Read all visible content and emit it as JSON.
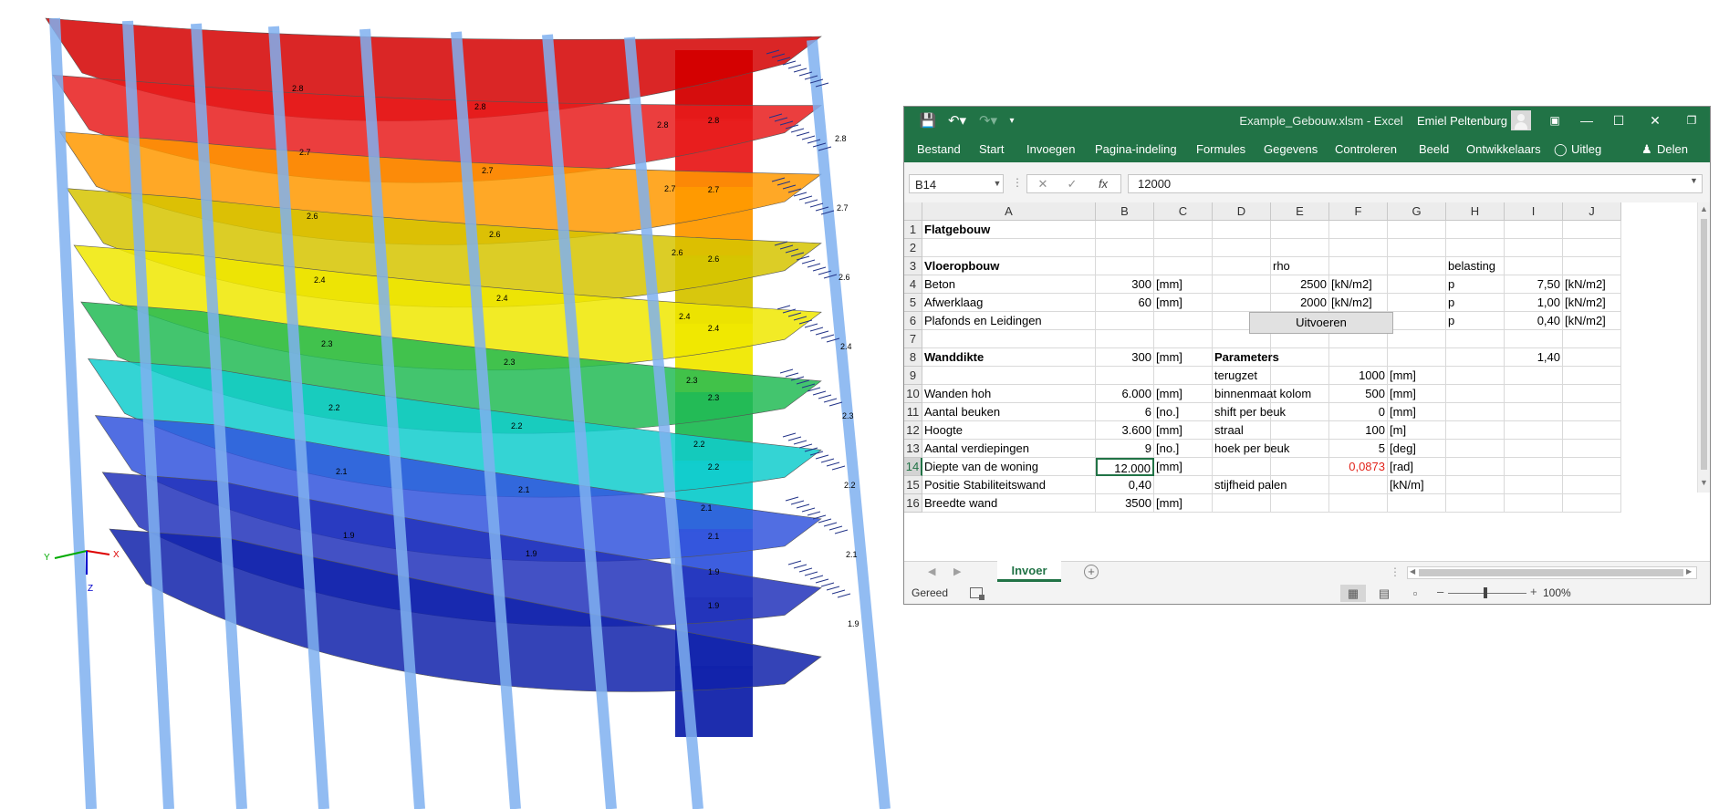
{
  "excel": {
    "file_title": "Example_Gebouw.xlsm  -  Excel",
    "user_name": "Emiel Peltenburg",
    "tabs": [
      "Bestand",
      "Start",
      "Invoegen",
      "Pagina-indeling",
      "Formules",
      "Gegevens",
      "Controleren",
      "Beeld",
      "Ontwikkelaars",
      "Uitleg",
      "Delen"
    ],
    "name_box": "B14",
    "formula_value": "12000",
    "fx_label": "fx",
    "column_headers": [
      "A",
      "B",
      "C",
      "D",
      "E",
      "F",
      "G",
      "H",
      "I",
      "J"
    ],
    "row_numbers": [
      "1",
      "2",
      "3",
      "4",
      "5",
      "6",
      "7",
      "8",
      "9",
      "10",
      "11",
      "12",
      "13",
      "14",
      "15",
      "16"
    ],
    "cells": {
      "A1": "Flatgebouw",
      "A3": "Vloeropbouw",
      "E3": "rho",
      "H3": "belasting",
      "A4": "Beton",
      "B4": "300",
      "C4": "[mm]",
      "E4": "2500",
      "F4": "[kN/m2]",
      "H4": "p",
      "I4": "7,50",
      "J4": "[kN/m2]",
      "A5": "Afwerklaag",
      "B5": "60",
      "C5": "[mm]",
      "E5": "2000",
      "F5": "[kN/m2]",
      "H5": "p",
      "I5": "1,00",
      "J5": "[kN/m2]",
      "A6": "Plafonds en Leidingen",
      "H6": "p",
      "I6": "0,40",
      "J6": "[kN/m2]",
      "A8": "Wanddikte",
      "B8": "300",
      "C8": "[mm]",
      "D8": "Parameters",
      "I8": "1,40",
      "D9": "terugzet",
      "F9": "1000",
      "G9": "[mm]",
      "A10": "Wanden hoh",
      "B10": "6.000",
      "C10": "[mm]",
      "D10": "binnenmaat kolom",
      "F10": "500",
      "G10": "[mm]",
      "A11": "Aantal beuken",
      "B11": "6",
      "C11": "[no.]",
      "D11": "shift per beuk",
      "F11": "0",
      "G11": "[mm]",
      "A12": "Hoogte",
      "B12": "3.600",
      "C12": "[mm]",
      "D12": "straal",
      "F12": "100",
      "G12": "[m]",
      "A13": "Aantal verdiepingen",
      "B13": "9",
      "C13": "[no.]",
      "D13": "hoek per beuk",
      "F13": "5",
      "G13": "[deg]",
      "A14": "Diepte van de woning",
      "B14": "12.000",
      "C14": "[mm]",
      "F14": "0,0873",
      "G14": "[rad]",
      "A15": "Positie Stabiliteitswand",
      "B15": "0,40",
      "D15": "stijfheid palen",
      "G15": "[kN/m]",
      "A16": "Breedte wand",
      "B16": "3500",
      "C16": "[mm]"
    },
    "button_label": "Uitvoeren",
    "sheet_tab": "Invoer",
    "status": "Gereed",
    "zoom": "100%",
    "accent_color": "#217346"
  },
  "model": {
    "slab_labels": [
      [
        "2.8",
        "2.8",
        "2.8"
      ],
      [
        "2.7",
        "2.7",
        "2.7"
      ],
      [
        "2.6",
        "2.6",
        "2.6"
      ],
      [
        "2.4",
        "2.4",
        "2.4"
      ],
      [
        "2.3",
        "2.3",
        "2.3"
      ],
      [
        "2.2",
        "2.2",
        "2.2"
      ],
      [
        "2.1",
        "2.1",
        "2.1"
      ],
      [
        "1.9",
        "1.9",
        "1.9"
      ]
    ],
    "wall_labels": [
      "2.8",
      "2.7",
      "2.6",
      "2.4",
      "2.3",
      "2.2",
      "2.1",
      "1.9"
    ],
    "load_labels": [
      "2.8",
      "2.7",
      "2.6",
      "2.4",
      "2.3",
      "2.2",
      "2.1",
      "1.9"
    ],
    "axis_labels": [
      "Y",
      "X",
      "Z"
    ],
    "colors": [
      "#d40000",
      "#ff9900",
      "#c8c800",
      "#e0e000",
      "#33cc33",
      "#00cccc",
      "#3399ff",
      "#2233cc"
    ]
  }
}
